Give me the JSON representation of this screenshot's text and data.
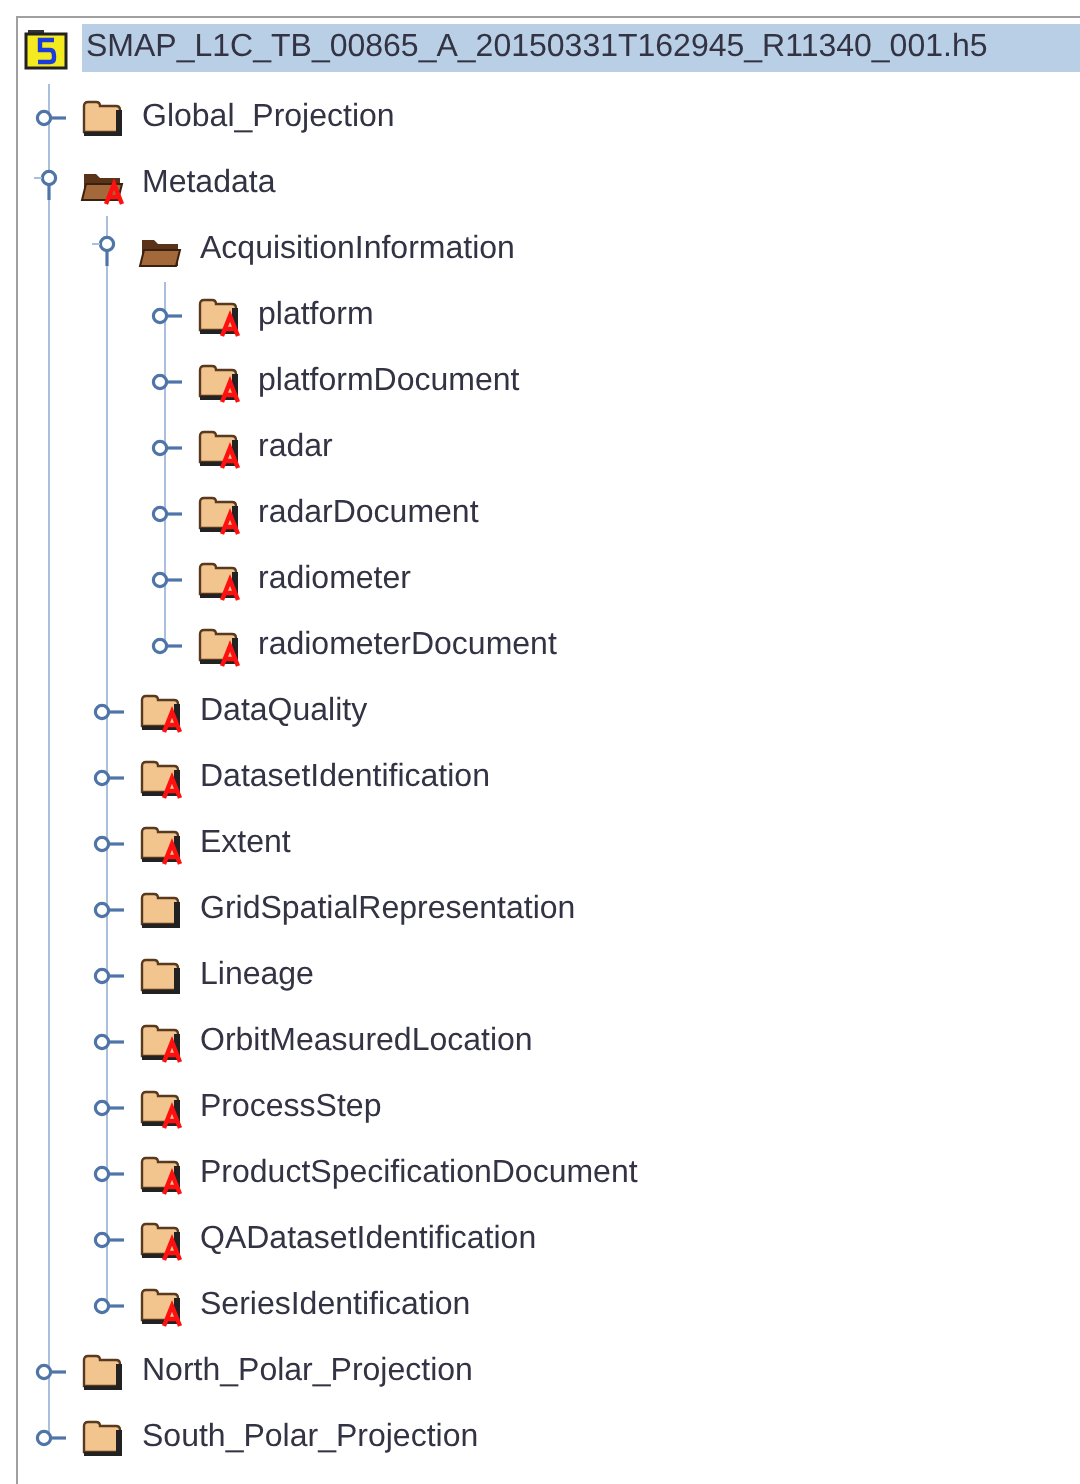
{
  "tree": {
    "label": "SMAP_L1C_TB_00865_A_20150331T162945_R11340_001.h5",
    "kind": "file",
    "selected": true,
    "children": [
      {
        "label": "Global_Projection",
        "kind": "group",
        "selected": false,
        "expanded": false,
        "attributes": false
      },
      {
        "label": "Metadata",
        "kind": "group",
        "selected": false,
        "expanded": true,
        "attributes": true,
        "children": [
          {
            "label": "AcquisitionInformation",
            "kind": "group",
            "selected": false,
            "expanded": true,
            "attributes": false,
            "children": [
              {
                "label": "platform",
                "kind": "group",
                "selected": false,
                "expanded": false,
                "attributes": true
              },
              {
                "label": "platformDocument",
                "kind": "group",
                "selected": false,
                "expanded": false,
                "attributes": true
              },
              {
                "label": "radar",
                "kind": "group",
                "selected": false,
                "expanded": false,
                "attributes": true
              },
              {
                "label": "radarDocument",
                "kind": "group",
                "selected": false,
                "expanded": false,
                "attributes": true
              },
              {
                "label": "radiometer",
                "kind": "group",
                "selected": false,
                "expanded": false,
                "attributes": true
              },
              {
                "label": "radiometerDocument",
                "kind": "group",
                "selected": false,
                "expanded": false,
                "attributes": true
              }
            ]
          },
          {
            "label": "DataQuality",
            "kind": "group",
            "selected": false,
            "expanded": false,
            "attributes": true
          },
          {
            "label": "DatasetIdentification",
            "kind": "group",
            "selected": false,
            "expanded": false,
            "attributes": true
          },
          {
            "label": "Extent",
            "kind": "group",
            "selected": false,
            "expanded": false,
            "attributes": true
          },
          {
            "label": "GridSpatialRepresentation",
            "kind": "group",
            "selected": false,
            "expanded": false,
            "attributes": false
          },
          {
            "label": "Lineage",
            "kind": "group",
            "selected": false,
            "expanded": false,
            "attributes": false
          },
          {
            "label": "OrbitMeasuredLocation",
            "kind": "group",
            "selected": false,
            "expanded": false,
            "attributes": true
          },
          {
            "label": "ProcessStep",
            "kind": "group",
            "selected": false,
            "expanded": false,
            "attributes": true
          },
          {
            "label": "ProductSpecificationDocument",
            "kind": "group",
            "selected": false,
            "expanded": false,
            "attributes": true
          },
          {
            "label": "QADatasetIdentification",
            "kind": "group",
            "selected": false,
            "expanded": false,
            "attributes": true
          },
          {
            "label": "SeriesIdentification",
            "kind": "group",
            "selected": false,
            "expanded": false,
            "attributes": true
          }
        ]
      },
      {
        "label": "North_Polar_Projection",
        "kind": "group",
        "selected": false,
        "expanded": false,
        "attributes": false
      },
      {
        "label": "South_Polar_Projection",
        "kind": "group",
        "selected": false,
        "expanded": false,
        "attributes": false
      }
    ]
  }
}
